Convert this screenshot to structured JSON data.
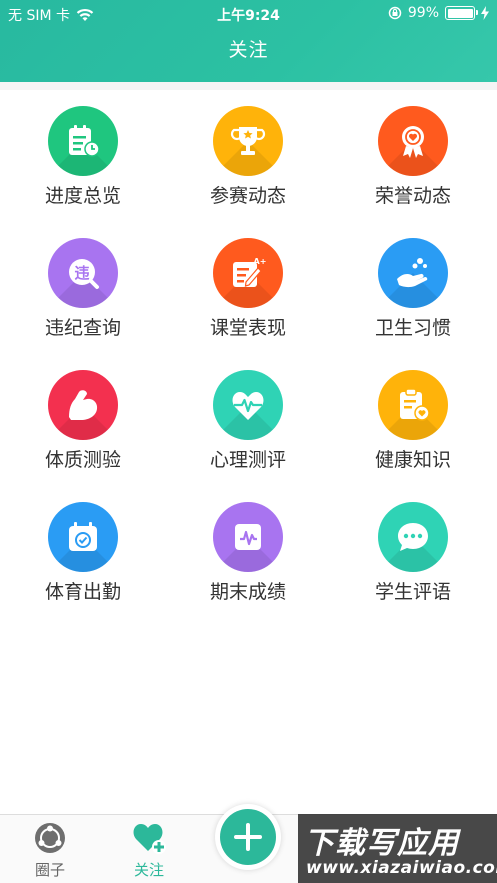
{
  "status_bar": {
    "carrier": "无 SIM 卡",
    "time": "上午9:24",
    "battery": "99%",
    "icons": [
      "wifi-icon",
      "rotation-lock-icon",
      "battery-icon",
      "charging-icon"
    ]
  },
  "header": {
    "title": "关注",
    "color": "#2cbea2"
  },
  "grid": {
    "items": [
      {
        "label": "进度总览",
        "icon": "schedule-icon",
        "color": "#1fc67f"
      },
      {
        "label": "参赛动态",
        "icon": "trophy-icon",
        "color": "#ffb30a"
      },
      {
        "label": "荣誉动态",
        "icon": "medal-icon",
        "color": "#ff5a1e"
      },
      {
        "label": "违纪查询",
        "icon": "violation-search-icon",
        "color": "#a874f0"
      },
      {
        "label": "课堂表现",
        "icon": "edit-note-icon",
        "color": "#ff5a1e"
      },
      {
        "label": "卫生习惯",
        "icon": "hygiene-hand-icon",
        "color": "#2a9cf4"
      },
      {
        "label": "体质测验",
        "icon": "muscle-arm-icon",
        "color": "#f3304f"
      },
      {
        "label": "心理测评",
        "icon": "heartbeat-icon",
        "color": "#2fd3b5"
      },
      {
        "label": "健康知识",
        "icon": "health-clipboard-icon",
        "color": "#ffb30a"
      },
      {
        "label": "体育出勤",
        "icon": "calendar-check-icon",
        "color": "#2a9cf4"
      },
      {
        "label": "期末成绩",
        "icon": "score-chart-icon",
        "color": "#a874f0"
      },
      {
        "label": "学生评语",
        "icon": "chat-bubble-icon",
        "color": "#2fd3b5"
      }
    ]
  },
  "tabbar": {
    "tabs": [
      {
        "label": "圈子",
        "icon": "circle-group-icon",
        "active": false
      },
      {
        "label": "关注",
        "icon": "heart-plus-icon",
        "active": true
      }
    ],
    "add_icon": "plus-icon",
    "active_color": "#2cb89a",
    "inactive_color": "#666666"
  },
  "watermark": {
    "main": "下载写应用",
    "sub": "www.xiazaiwiao.com"
  }
}
